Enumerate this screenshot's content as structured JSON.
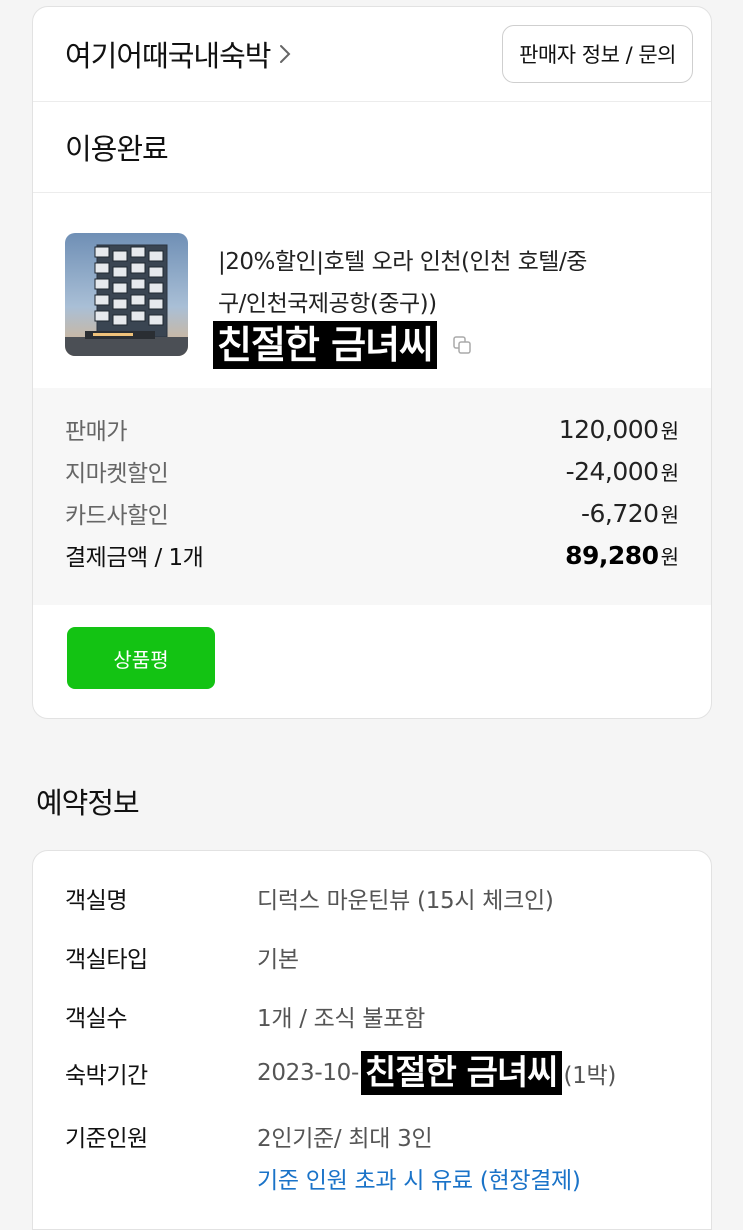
{
  "seller": {
    "name": "여기어때국내숙박",
    "info_button": "판매자 정보 / 문의"
  },
  "order": {
    "status": "이용완료",
    "product_title": "|20%할인|호텔 오라 인천(인천 호텔/중구/인천국제공항(중구))",
    "option_text": "친절한 금녀씨",
    "copy_icon": "copy-icon",
    "prices": [
      {
        "label": "판매가",
        "value": "120,000",
        "unit": "원"
      },
      {
        "label": "지마켓할인",
        "value": "-24,000",
        "unit": "원"
      },
      {
        "label": "카드사할인",
        "value": "-6,720",
        "unit": "원"
      },
      {
        "label": "결제금액 / 1개",
        "value": "89,280",
        "unit": "원"
      }
    ],
    "review_button": "상품평"
  },
  "reservation": {
    "section_title": "예약정보",
    "rows": [
      {
        "label": "객실명",
        "value": "디럭스 마운틴뷰 (15시 체크인)"
      },
      {
        "label": "객실타입",
        "value": "기본"
      },
      {
        "label": "객실수",
        "value": "1개 / 조식 불포함"
      },
      {
        "label": "숙박기간",
        "value_prefix": "2023-10-",
        "value_masked": "친절한 금녀씨",
        "value_suffix": "(1박)"
      },
      {
        "label": "기준인원",
        "value": "2인기준/ 최대 3인",
        "note": "기준 인원 초과 시 유료 (현장결제)"
      }
    ]
  },
  "colors": {
    "review_button": "#13c313",
    "link": "#1a73c8",
    "price_box_bg": "#f7f7f7"
  }
}
